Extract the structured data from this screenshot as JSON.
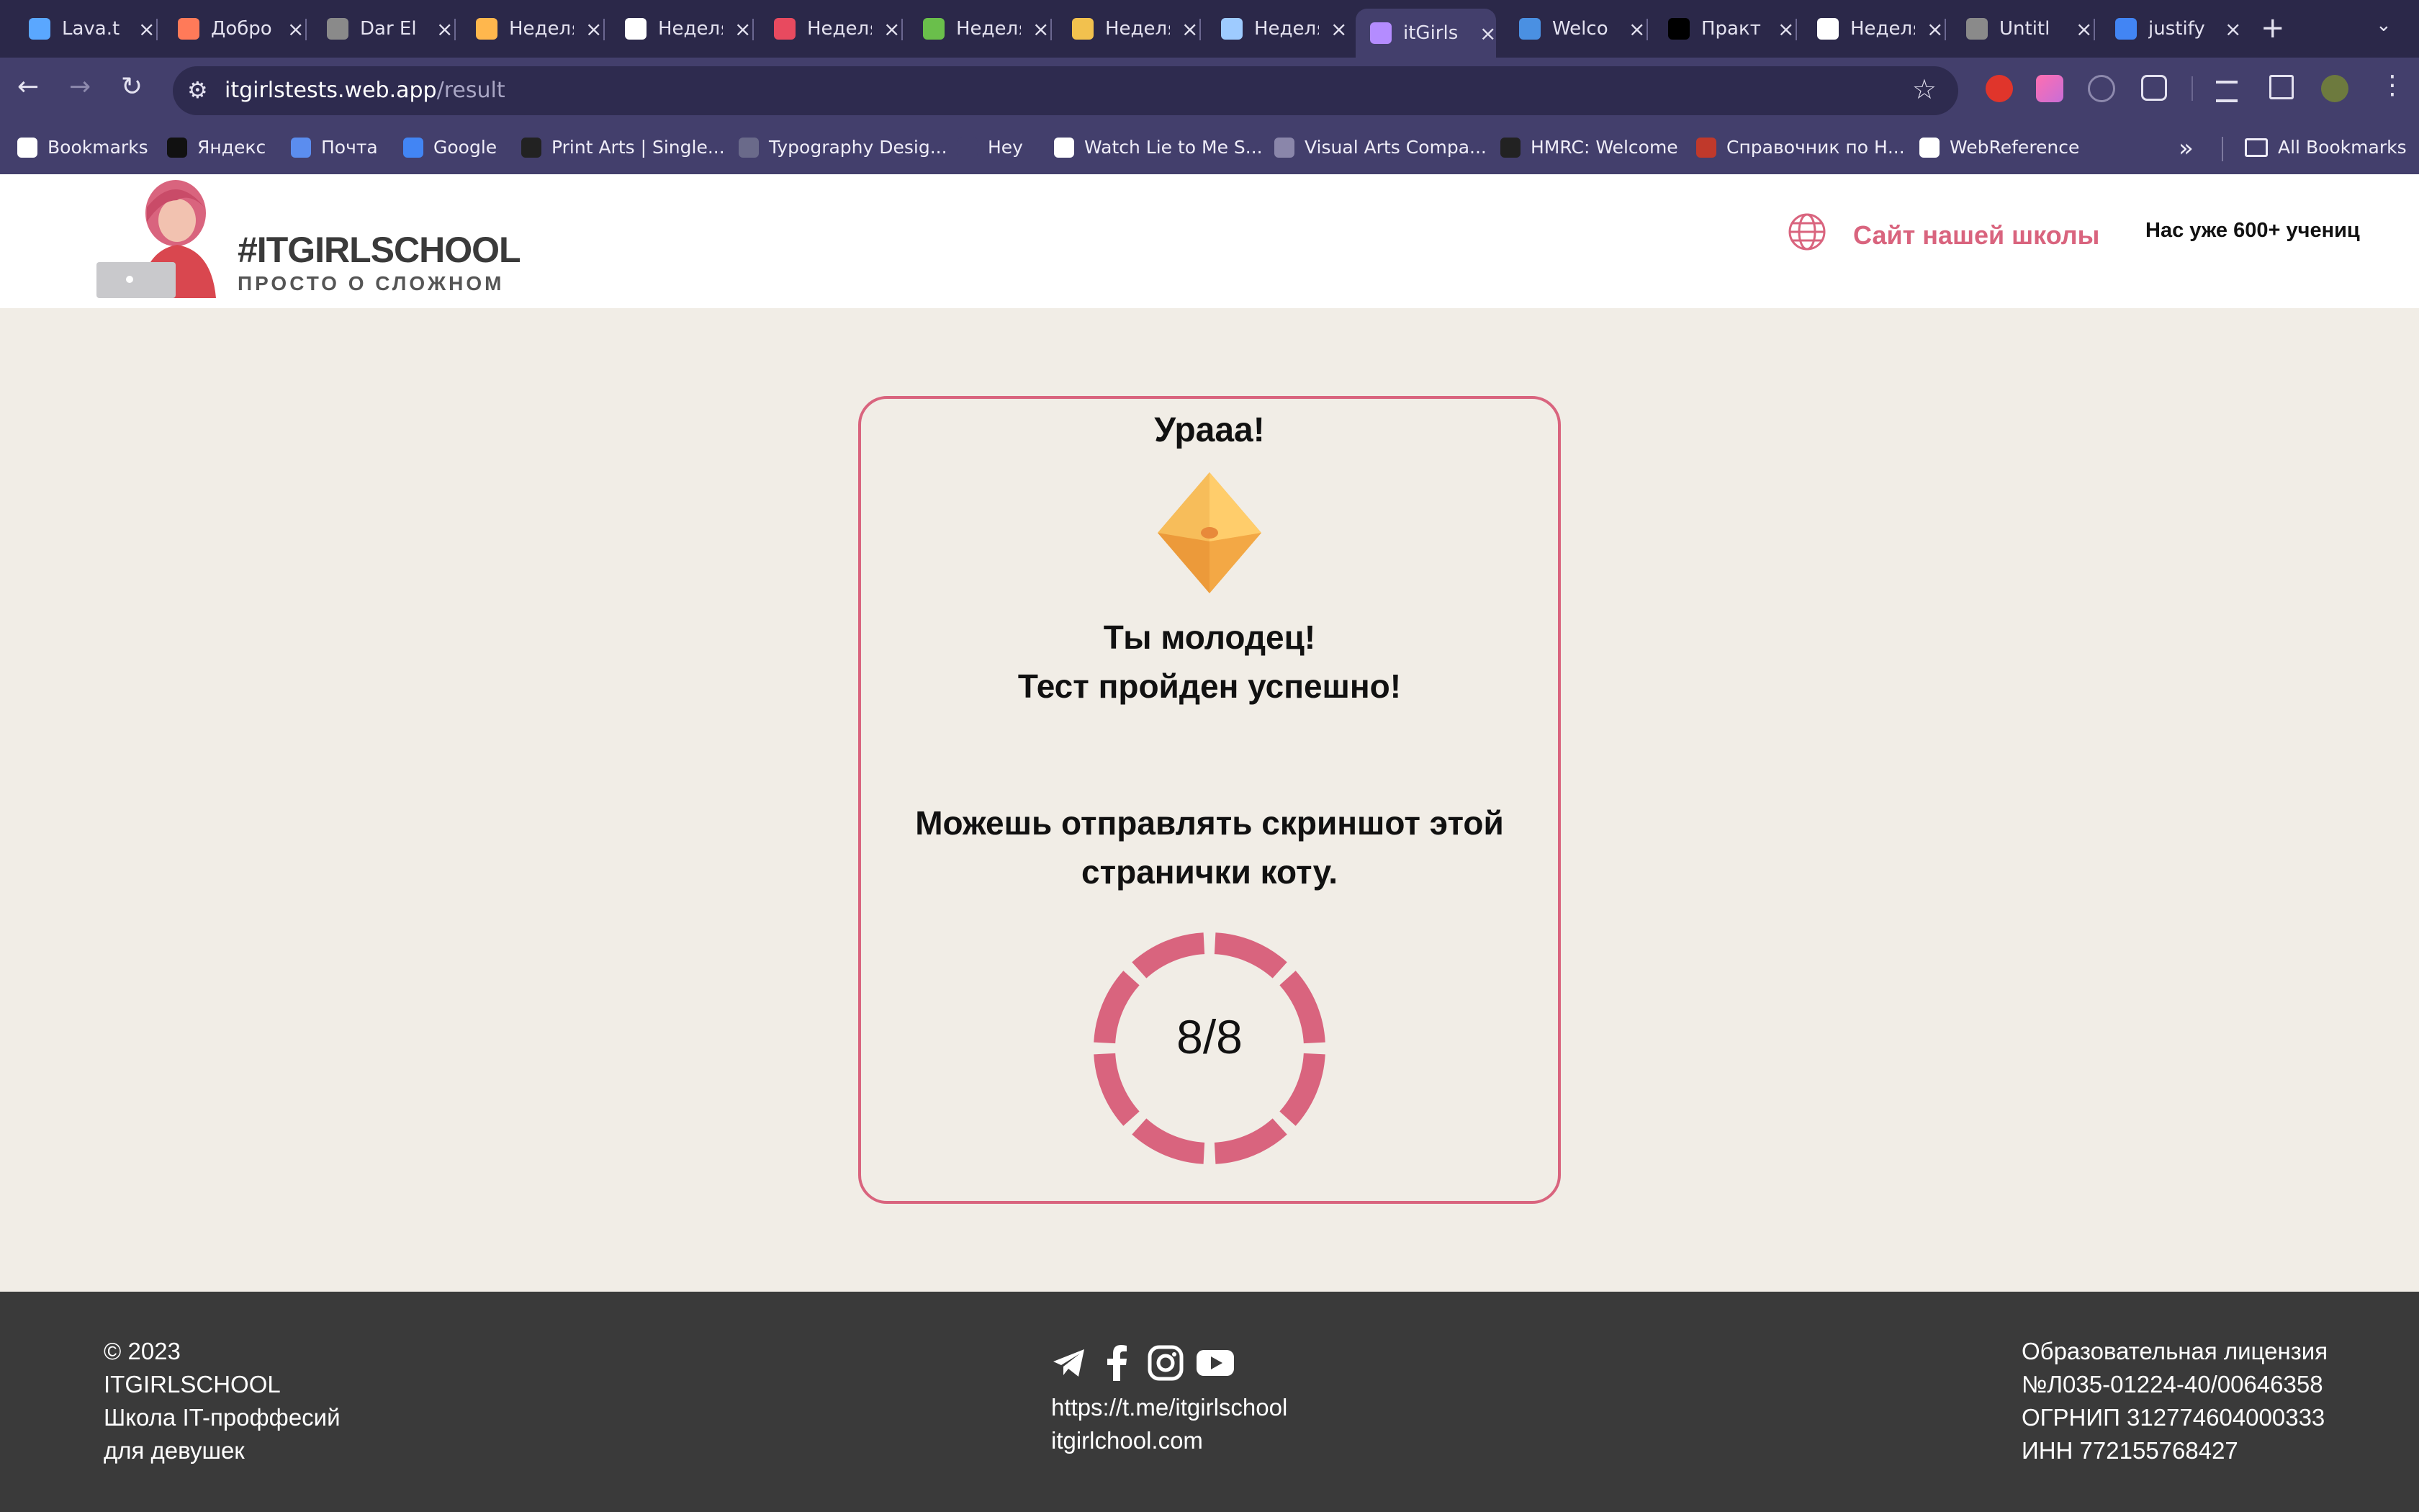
{
  "browser": {
    "tabs": [
      {
        "title": "Lava.t",
        "color": "#5aa7ff"
      },
      {
        "title": "Добро",
        "color": "#ff7a59"
      },
      {
        "title": "Dar El",
        "color": "#8a8a8a"
      },
      {
        "title": "Неделя",
        "color": "#ffb74d"
      },
      {
        "title": "Неделя",
        "color": "#ffffff"
      },
      {
        "title": "Неделя",
        "color": "#e84a5f"
      },
      {
        "title": "Неделя",
        "color": "#6abf4b"
      },
      {
        "title": "Неделя",
        "color": "#f2c14e"
      },
      {
        "title": "Неделя",
        "color": "#9ecbff"
      },
      {
        "title": "itGirls",
        "color": "#b48cff",
        "active": true
      },
      {
        "title": "Welco",
        "color": "#4a90e2"
      },
      {
        "title": "Практ",
        "color": "#000000"
      },
      {
        "title": "Неделя",
        "color": "#ffffff"
      },
      {
        "title": "Untitl",
        "color": "#8a8a8a"
      },
      {
        "title": "justify",
        "color": "#4285f4"
      }
    ],
    "new_tab": "+",
    "url_host": "itgirlstests.web.app",
    "url_path": "/result",
    "bookmarks": [
      {
        "label": "Bookmarks",
        "color": "#ffffff"
      },
      {
        "label": "Яндекс",
        "color": "#111111"
      },
      {
        "label": "Почта",
        "color": "#5b8def"
      },
      {
        "label": "Google",
        "color": "#4285f4"
      },
      {
        "label": "Print Arts | Single...",
        "color": "#222222"
      },
      {
        "label": "Typography Desig...",
        "color": "#6a6a8a"
      },
      {
        "label": "Hey",
        "color": "#433f6c"
      },
      {
        "label": "Watch Lie to Me S...",
        "color": "#ffffff"
      },
      {
        "label": "Visual Arts Compa...",
        "color": "#8a86aa"
      },
      {
        "label": "HMRC: Welcome",
        "color": "#222222"
      },
      {
        "label": "Справочник по Н...",
        "color": "#c0392b"
      },
      {
        "label": "WebReference",
        "color": "#ffffff"
      }
    ],
    "all_bookmarks": "All Bookmarks"
  },
  "header": {
    "logo_title": "#ITGIRLSCHOOL",
    "logo_subtitle": "ПРОСТО О СЛОЖНОМ",
    "school_link": "Сайт нашей школы",
    "students": "Нас уже 600+ учениц"
  },
  "result": {
    "heading": "Урааа!",
    "message_line1": "Ты молодец!",
    "message_line2": "Тест пройден успешно!",
    "note_line1": "Можешь отправлять скриншот этой",
    "note_line2": "странички коту.",
    "score": "8/8",
    "correct": 8,
    "total": 8,
    "ring_color": "#d9647e"
  },
  "footer": {
    "copyright": "© 2023",
    "company": "ITGIRLSCHOOL",
    "tagline_line1": "Школа IT-проффесий",
    "tagline_line2": "для девушек",
    "telegram_url": "https://t.me/itgirlschool",
    "site": "itgirlchool.com",
    "license_title": "Образовательная лицензия",
    "license_number": "№Л035-01224-40/00646358",
    "ogrnip": "ОГРНИП 312774604000333",
    "inn": "ИНН 772155768427",
    "social_icons": [
      "telegram-icon",
      "facebook-icon",
      "instagram-icon",
      "youtube-icon"
    ]
  }
}
